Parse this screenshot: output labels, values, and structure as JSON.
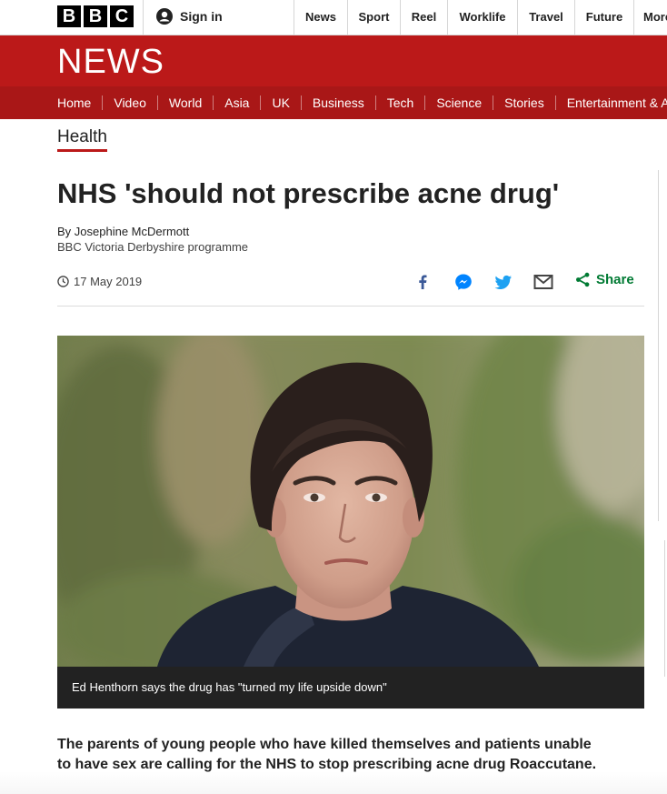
{
  "brand": {
    "logo_letters": [
      "B",
      "B",
      "C"
    ],
    "news_word": "NEWS"
  },
  "header": {
    "signin_label": "Sign in",
    "top_nav": [
      "News",
      "Sport",
      "Reel",
      "Worklife",
      "Travel",
      "Future",
      "More"
    ]
  },
  "section_nav": [
    "Home",
    "Video",
    "World",
    "Asia",
    "UK",
    "Business",
    "Tech",
    "Science",
    "Stories",
    "Entertainment & Arts"
  ],
  "article": {
    "section": "Health",
    "headline": "NHS 'should not prescribe acne drug'",
    "author": "By Josephine McDermott",
    "author_role": "BBC Victoria Derbyshire programme",
    "date": "17 May 2019",
    "share_label": "Share",
    "image_caption": "Ed Henthorn says the drug has \"turned my life upside down\"",
    "intro": "The parents of young people who have killed themselves and patients unable to have sex are calling for the NHS to stop prescribing acne drug Roaccutane."
  },
  "icons": {
    "user": "user-icon",
    "clock": "clock-icon",
    "facebook": "facebook-icon",
    "messenger": "messenger-icon",
    "twitter": "twitter-icon",
    "email": "email-icon",
    "share": "share-icon"
  },
  "colors": {
    "bbc_red": "#bb1919",
    "nav_red": "#a91717",
    "share_green": "#007a33",
    "facebook_blue": "#3b5998",
    "messenger_blue": "#0084ff",
    "twitter_blue": "#1da1f2",
    "caption_bg": "#222222"
  }
}
